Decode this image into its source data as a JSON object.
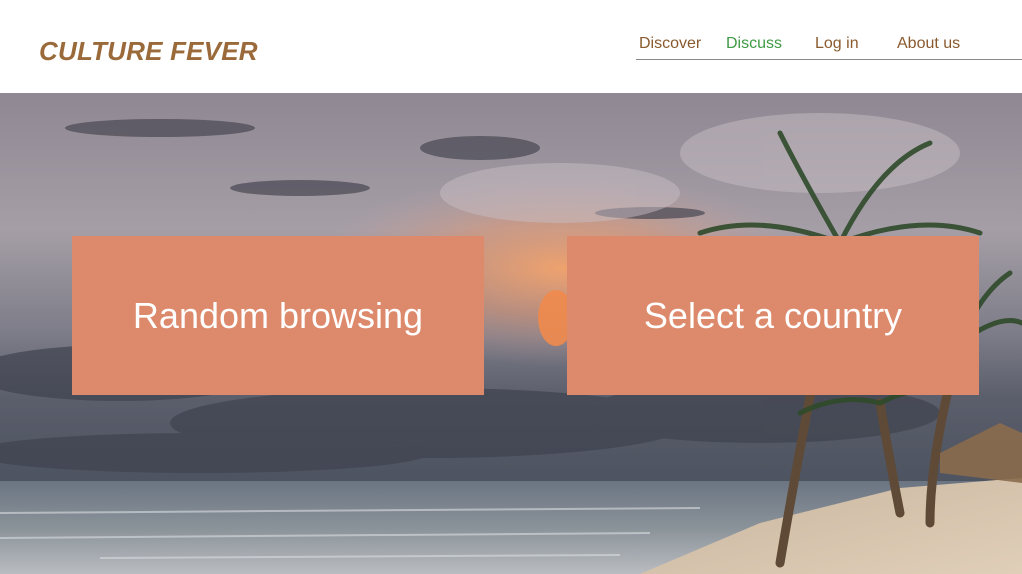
{
  "header": {
    "logo": "CULTURE FEVER",
    "nav": [
      {
        "label": "Discover"
      },
      {
        "label": "Discuss"
      },
      {
        "label": "Log in"
      },
      {
        "label": "About us"
      }
    ],
    "active_nav": "Discuss"
  },
  "hero": {
    "background": "beach-palm-sunset-photo",
    "buttons": {
      "random": "Random browsing",
      "country": "Select a country"
    }
  },
  "colors": {
    "logo": "#9a6a3a",
    "nav_text": "#8a5a2e",
    "nav_active": "#3f9a45",
    "button_bg": "#dd896c",
    "button_text": "#ffffff"
  }
}
